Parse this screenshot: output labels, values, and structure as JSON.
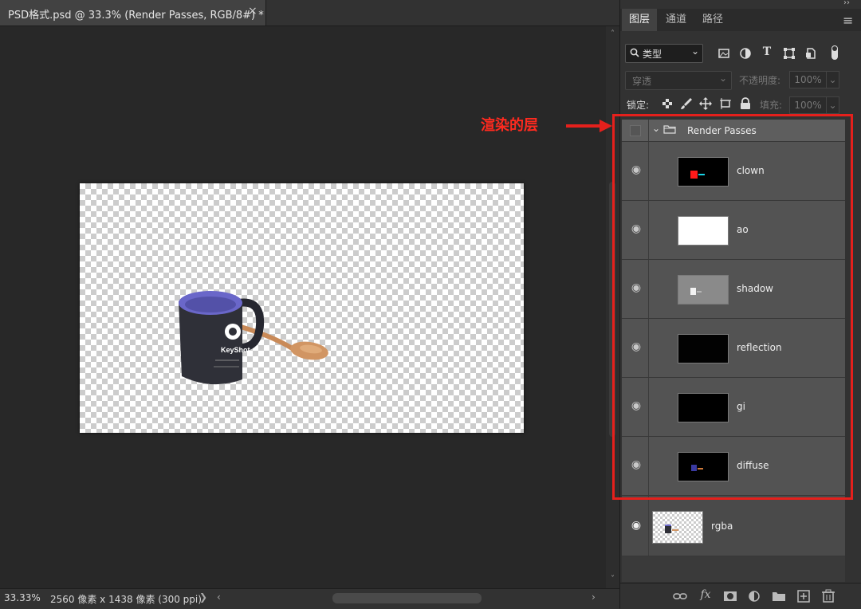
{
  "document_tab": {
    "title": "PSD格式.psd @ 33.3% (Render Passes, RGB/8#) *",
    "close": "×"
  },
  "status_bar": {
    "zoom": "33.33%",
    "doc_info": "2560 像素 x 1438 像素 (300 ppi)",
    "arrow": "❯",
    "scroll_left": "‹",
    "scroll_right": "›"
  },
  "scrollbar": {
    "up": "˄",
    "down": "˅"
  },
  "panel": {
    "collapse": "››",
    "tabs": [
      {
        "label": "图层",
        "active": true
      },
      {
        "label": "通道"
      },
      {
        "label": "路径"
      }
    ],
    "menu_icon": "≡",
    "filter": {
      "label": "类型",
      "chevron": "⌄"
    },
    "blend_mode": {
      "value": "穿透",
      "chevron": "⌄"
    },
    "opacity": {
      "label": "不透明度:",
      "value": "100%",
      "chevron": "⌄"
    },
    "lock": {
      "label": "锁定:"
    },
    "fill": {
      "label": "填充:",
      "value": "100%",
      "chevron": "⌄"
    },
    "icons": {
      "filter_pixel": "image-icon",
      "filter_adjust": "half-circle-icon",
      "filter_type": "T",
      "filter_shape": "transform-icon",
      "filter_smart": "smart-object-icon",
      "lock_transparent": "checker-icon",
      "lock_pixels": "brush-icon",
      "lock_position": "move-icon",
      "lock_artboard": "crop-icon",
      "lock_all": "lock-icon"
    }
  },
  "layers": {
    "group": {
      "name": "Render Passes",
      "chevron": "⌄"
    },
    "eye": "◉",
    "children": [
      {
        "name": "clown",
        "thumb_bg": "#000000"
      },
      {
        "name": "ao",
        "thumb_bg": "#ffffff"
      },
      {
        "name": "shadow",
        "thumb_bg": "#8a8a8a"
      },
      {
        "name": "reflection",
        "thumb_bg": "#020202"
      },
      {
        "name": "gi",
        "thumb_bg": "#000000"
      },
      {
        "name": "diffuse",
        "thumb_bg": "#000000"
      }
    ],
    "root": {
      "name": "rgba"
    }
  },
  "bottom_icons": [
    "link-icon",
    "fx-icon",
    "mask-icon",
    "adjustment-icon",
    "folder-icon",
    "new-layer-icon",
    "trash-icon"
  ],
  "bottom_glyphs": {
    "fx": "fx"
  },
  "annotation": {
    "label": "渲染的层",
    "color": "#e5201c"
  },
  "canvas": {
    "mug_color": "#2f3038",
    "mug_inner": "#6a67c9",
    "spoon_color": "#d19563",
    "mug_text": "KeyShot"
  }
}
